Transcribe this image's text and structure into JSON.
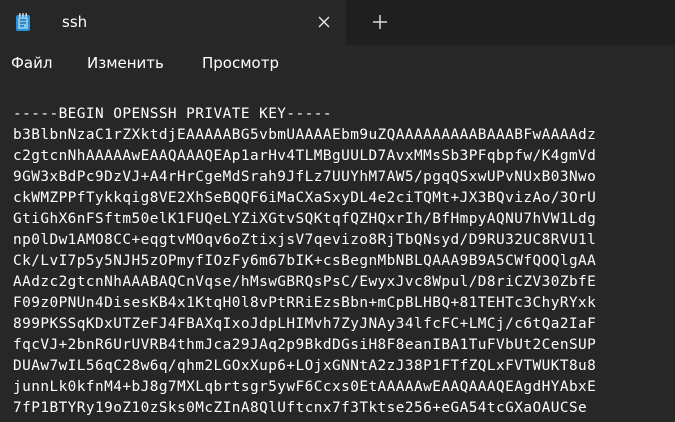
{
  "tab": {
    "title": "ssh",
    "close_icon": "close-icon",
    "add_icon": "plus-icon"
  },
  "menu": {
    "items": [
      "Файл",
      "Изменить",
      "Просмотр"
    ]
  },
  "document": {
    "lines": [
      "-----BEGIN OPENSSH PRIVATE KEY-----",
      "b3BlbnNzaC1rZXktdjEAAAAABG5vbmUAAAAEbm9uZQAAAAAAAAABAAABFwAAAAdz",
      "c2gtcnNhAAAAAwEAAQAAAQEAp1arHv4TLMBgUULD7AvxMMsSb3PFqbpfw/K4gmVd",
      "9GW3xBdPc9DzVJ+A4rHrCgeMdSrah9JfLz7UUYhM7AW5/pgqQSxwUPvNUxB03Nwo",
      "ckWMZPPfTykkqig8VE2XhSeBQQF6iMaCXaSxyDL4e2ciTQMt+JX3BQvizAo/3OrU",
      "GtiGhX6nFSftm50elK1FUQeLYZiXGtvSQKtqfQZHQxrIh/BfHmpyAQNU7hVW1Ldg",
      "np0lDw1AMO8CC+eqgtvMOqv6oZtixjsV7qevizo8RjTbQNsyd/D9RU32UC8RVU1l",
      "Ck/LvI7p5y5NJH5zOPmyfIOzFy6m67bIK+csBegnMbNBLQAAA9B9A5CWfQOQlgAA",
      "AAdzc2gtcnNhAAABAQCnVqse/hMswGBRQsPsC/EwyxJvc8Wpul/D8riCZV30ZbfE",
      "F09z0PNUn4DisesKB4x1KtqH0l8vPtRRiEzsBbn+mCpBLHBQ+81TEHTc3ChyRYxk",
      "899PKSSqKDxUTZeFJ4FBAXqIxoJdpLHIMvh7ZyJNAy34lfcFC+LMCj/c6tQa2IaF",
      "fqcVJ+2bnR6UrUVRB4thmJca29JAq2p9BkdDGsiH8F8eanIBA1TuFVbUt2CenSUP",
      "DUAw7wIL56qC28w6q/qhm2LGOxXup6+LOjxGNNtA2zJ38P1FTfZQLxFVTWUKT8u8",
      "junnLk0kfnM4+bJ8g7MXLqbrtsgr5ywF6Ccxs0EtAAAAAwEAAQAAAQEAgdHYAbxE",
      "7fP1BTYRy19oZ10zSks0McZInA8QlUftcnx7f3Tktse256+eGA54tcGXaOAUCSe"
    ]
  }
}
